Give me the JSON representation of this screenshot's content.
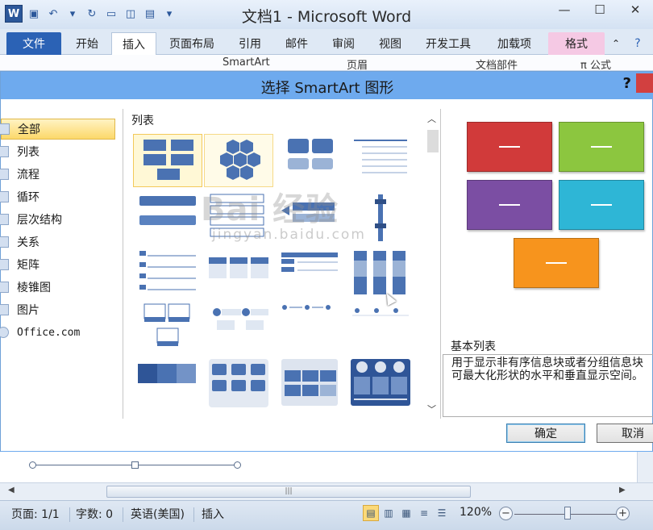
{
  "window": {
    "title": "文档1 - Microsoft Word",
    "app_icon": "W"
  },
  "ribbon": {
    "tabs": [
      "文件",
      "开始",
      "插入",
      "页面布局",
      "引用",
      "邮件",
      "审阅",
      "视图",
      "开发工具",
      "加载项",
      "格式"
    ],
    "active_tab": "插入",
    "partial_items": [
      "SmartArt",
      "页眉",
      "文档部件",
      "π 公式"
    ]
  },
  "dialog": {
    "title": "选择 SmartArt 图形",
    "help": "?",
    "categories": [
      "全部",
      "列表",
      "流程",
      "循环",
      "层次结构",
      "关系",
      "矩阵",
      "棱锥图",
      "图片",
      "Office.com"
    ],
    "selected_category": "全部",
    "gallery_heading": "列表",
    "preview": {
      "colors": [
        "#d13a3a",
        "#8cc63f",
        "#7b4ea3",
        "#2eb6d6",
        "#f7941d"
      ],
      "name": "基本列表",
      "description_line1": "用于显示非有序信息块或者分组信息块",
      "description_line2": "可最大化形状的水平和垂直显示空间。"
    },
    "ok_label": "确定",
    "cancel_label": "取消"
  },
  "statusbar": {
    "page": "页面: 1/1",
    "words": "字数: 0",
    "language": "英语(美国)",
    "mode": "插入",
    "zoom": "120%",
    "zoom_level_percent": 120
  },
  "watermark": {
    "text": "Bai 经验",
    "url_text": "jingyan.baidu.com"
  }
}
